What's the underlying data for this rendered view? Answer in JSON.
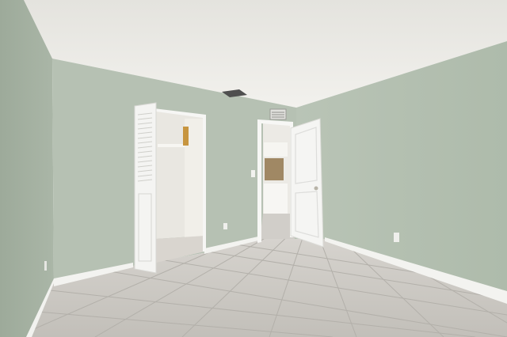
{
  "scene": {
    "description_label": "",
    "colors": {
      "ceiling": "#ecebe6",
      "wall_back": "#b7c2b4",
      "wall_left": "#a9b5a6",
      "wall_right": "#b4c0b1",
      "floor": "#c9c6c1",
      "floor_line": "#b2afa9",
      "baseboard": "#f4f4f1",
      "door": "#f3f3f1",
      "closet_interior": "#ebe9e3",
      "hall": "#f1f0ec",
      "vent": "#555555"
    }
  }
}
